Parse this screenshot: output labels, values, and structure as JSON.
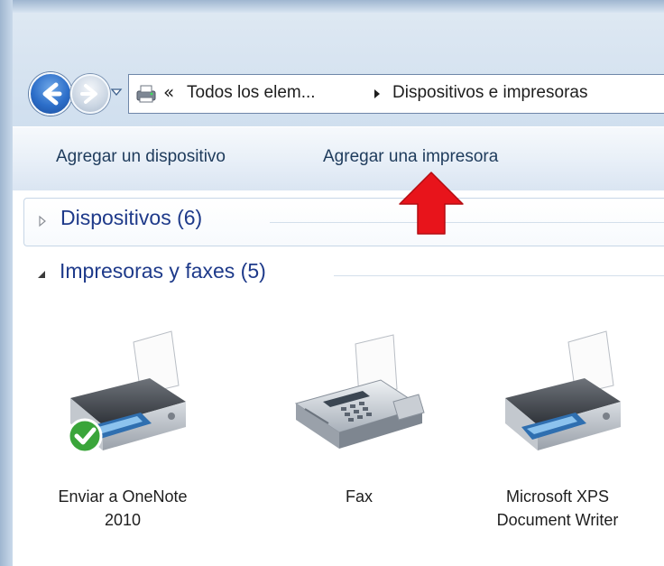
{
  "address_bar": {
    "chevron": "«",
    "crumbs": [
      "Todos los elem...",
      "Dispositivos e impresoras"
    ]
  },
  "command_bar": {
    "add_device": "Agregar un dispositivo",
    "add_printer": "Agregar una impresora"
  },
  "groups": [
    {
      "title": "Dispositivos (6)",
      "expanded": false
    },
    {
      "title": "Impresoras y faxes (5)",
      "expanded": true
    }
  ],
  "devices": [
    {
      "label_line1": "Enviar a OneNote",
      "label_line2": "2010",
      "icon": "printer-icon",
      "default": true
    },
    {
      "label_line1": "Fax",
      "label_line2": "",
      "icon": "fax-icon",
      "default": false
    },
    {
      "label_line1": "Microsoft XPS",
      "label_line2": "Document Writer",
      "icon": "printer-icon",
      "default": false
    }
  ],
  "colors": {
    "accent": "#1e3a8a",
    "annotation_arrow": "#e8141b",
    "default_badge": "#3aa53a"
  }
}
